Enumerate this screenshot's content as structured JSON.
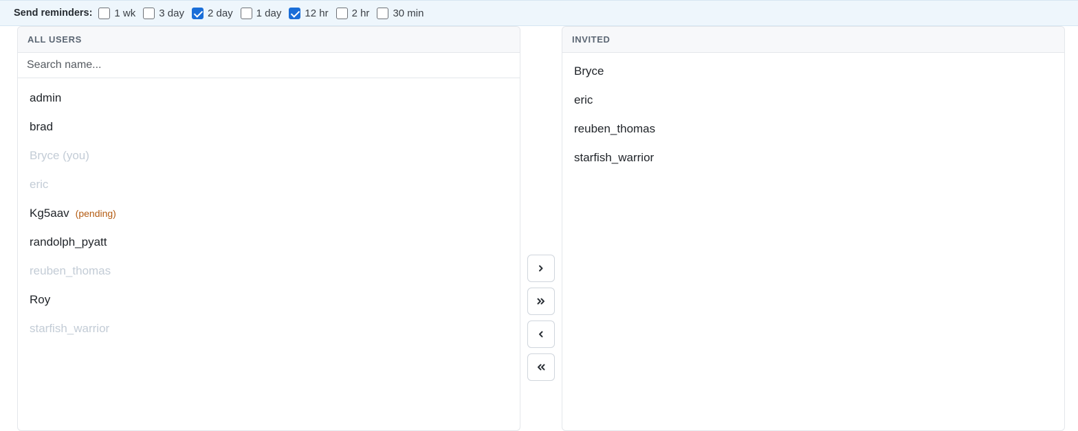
{
  "reminders": {
    "label": "Send reminders:",
    "options": [
      {
        "label": "1 wk",
        "checked": false
      },
      {
        "label": "3 day",
        "checked": false
      },
      {
        "label": "2 day",
        "checked": true
      },
      {
        "label": "1 day",
        "checked": false
      },
      {
        "label": "12 hr",
        "checked": true
      },
      {
        "label": "2 hr",
        "checked": false
      },
      {
        "label": "30 min",
        "checked": false
      }
    ]
  },
  "all_users": {
    "title": "ALL USERS",
    "search_placeholder": "Search name...",
    "search_value": "",
    "items": [
      {
        "name": "admin",
        "disabled": false,
        "badge": ""
      },
      {
        "name": "brad",
        "disabled": false,
        "badge": ""
      },
      {
        "name": "Bryce (you)",
        "disabled": true,
        "badge": ""
      },
      {
        "name": "eric",
        "disabled": true,
        "badge": ""
      },
      {
        "name": "Kg5aav",
        "disabled": false,
        "badge": "(pending)"
      },
      {
        "name": "randolph_pyatt",
        "disabled": false,
        "badge": ""
      },
      {
        "name": "reuben_thomas",
        "disabled": true,
        "badge": ""
      },
      {
        "name": "Roy",
        "disabled": false,
        "badge": ""
      },
      {
        "name": "starfish_warrior",
        "disabled": true,
        "badge": ""
      }
    ]
  },
  "invited": {
    "title": "INVITED",
    "items": [
      {
        "name": "Bryce"
      },
      {
        "name": "eric"
      },
      {
        "name": "reuben_thomas"
      },
      {
        "name": "starfish_warrior"
      }
    ]
  },
  "transfer_buttons": [
    {
      "icon": "chevron-right-icon"
    },
    {
      "icon": "double-chevron-right-icon"
    },
    {
      "icon": "chevron-left-icon"
    },
    {
      "icon": "double-chevron-left-icon"
    }
  ],
  "colors": {
    "accent": "#1a6ed8",
    "muted_text": "#c3ccd6",
    "pending": "#b35a10",
    "reminder_bar_bg": "#eef6fc"
  }
}
